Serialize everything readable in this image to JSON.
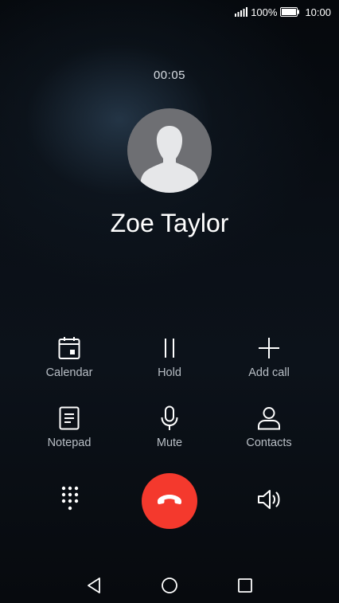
{
  "status_bar": {
    "battery_percent": "100%",
    "time": "10:00",
    "icons": [
      "signal-icon",
      "battery-icon"
    ]
  },
  "call": {
    "duration": "00:05",
    "contact_name": "Zoe Taylor"
  },
  "controls": [
    {
      "label": "Calendar",
      "icon": "calendar-icon"
    },
    {
      "label": "Hold",
      "icon": "pause-icon"
    },
    {
      "label": "Add call",
      "icon": "plus-icon"
    },
    {
      "label": "Notepad",
      "icon": "notepad-icon"
    },
    {
      "label": "Mute",
      "icon": "microphone-icon"
    },
    {
      "label": "Contacts",
      "icon": "person-icon"
    }
  ],
  "bottom_actions": {
    "keypad_icon": "keypad-icon",
    "end_call_icon": "end-call-icon",
    "speaker_icon": "speaker-icon"
  },
  "nav_bar": {
    "icons": [
      "back-icon",
      "home-icon",
      "recents-icon"
    ]
  },
  "colors": {
    "end_call": "#f4392d",
    "label": "#b9bfc6",
    "text": "#ffffff"
  }
}
